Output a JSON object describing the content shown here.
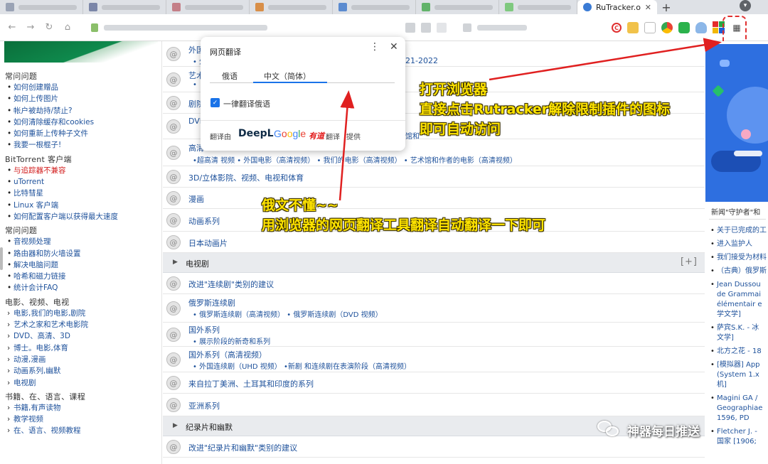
{
  "browser": {
    "active_tab_title": "RuTracker.o",
    "new_tab_glyph": "+",
    "tab_close_glyph": "✕"
  },
  "sidebar": {
    "sections": [
      {
        "title": "常问问题",
        "items": [
          "如何创建赠品",
          "如何上传图片",
          "帐户被劫持/禁止?",
          "如何清除缓存和cookies",
          "如何重新上传种子文件",
          "我要一根棍子!"
        ]
      },
      {
        "title": "BitTorrent 客户端",
        "items": [
          "与追踪器不兼容",
          "uTorrent",
          "比特彗星",
          "Linux 客户端",
          "如何配置客户端以获得最大速度"
        ]
      },
      {
        "title": "常问问题",
        "items": [
          "音视频处理",
          "路由器和防火墙设置",
          "解决电脑问题",
          "哈希和磁力链接",
          "统计会计FAQ"
        ]
      },
      {
        "title": "电影、视频、电视",
        "items": [
          "电影,我们的电影,剧院",
          "艺术之家和艺术电影院",
          "DVD、高清、3D",
          "博士。电影,体育",
          "动漫,漫画",
          "动画系列,幽默",
          "电视剧"
        ]
      },
      {
        "title": "书籍、在、语言、课程",
        "items": [
          "书籍,有声读物",
          "教学视频",
          "在、语言、视频教程"
        ]
      }
    ]
  },
  "main": {
    "rows": [
      {
        "title": "外国",
        "subs": "• 外",
        "suffix": "21-2022"
      },
      {
        "title": "艺术",
        "subs": "•"
      },
      {
        "title": "剧院",
        "subs": ""
      },
      {
        "title": "DVD",
        "subs": "",
        "suffix": "馆和"
      },
      {
        "title": "高清",
        "subs": "•超高清 视频 • 外国电影（高清视频） • 我们的电影（高清视频） • 艺术馆和作者的电影（高清视频）"
      },
      {
        "title": "3D/立体影院、视频、电视和体育",
        "subs": ""
      },
      {
        "title": "漫画",
        "subs": ""
      },
      {
        "title": "动画系列",
        "subs": ""
      },
      {
        "title": "日本动画片",
        "subs": ""
      }
    ],
    "cat_tv": {
      "title": "电视剧",
      "plus": "[+]"
    },
    "tv_rows": [
      {
        "title": "改进\"连续剧\"类别的建议",
        "subs": ""
      },
      {
        "title": "俄罗斯连续剧",
        "subs": "• 俄罗斯连续剧（高清视频） • 俄罗斯连续剧（DVD 视频）"
      },
      {
        "title": "国外系列",
        "subs": "• 展示阶段的新奇和系列"
      },
      {
        "title": "国外系列（高清视频）",
        "subs": "• 外国连续剧（UHD 视频） •新剧 和连续剧在表演阶段（高清视频）"
      },
      {
        "title": "来自拉丁美洲、土耳其和印度的系列",
        "subs": ""
      },
      {
        "title": "亚洲系列",
        "subs": ""
      }
    ],
    "cat_doc": {
      "title": "纪录片和幽默"
    },
    "doc_rows": [
      {
        "title": "改进\"纪录片和幽默\"类别的建议",
        "subs": ""
      }
    ]
  },
  "rightbar": {
    "heading": "新闻\"守护者\"和",
    "items": [
      "关于已完成的工",
      "进入监护人",
      "我们接受为材料",
      "（古典）俄罗斯",
      "Jean Dussou",
      "de Grammai",
      "élémentair e",
      "学文学]",
      "萨宾S.K. - 冰",
      "文学]",
      "北方之花 - 18",
      "[模拟器] App",
      "(System 1.x",
      "机]",
      "Magini GA /",
      "Geographiae",
      "1596, PD",
      "Fletcher J. -",
      "国家 [1906;"
    ]
  },
  "translate_popup": {
    "title": "网页翻译",
    "menu_glyph": "⋮",
    "close_glyph": "✕",
    "tab_source": "俄语",
    "tab_target": "中文（简体）",
    "checkbox_label": "一律翻译俄语",
    "checkbox_checked": true,
    "provided_prefix": "翻译由",
    "provider_deepl": "DeepL",
    "provider_google": "Google",
    "provider_youdao": "有道",
    "provider_fanyi": "翻译",
    "provided_suffix": "提供"
  },
  "annotations": {
    "top_right": [
      "打开浏览器",
      "直接点击Rutracker解除限制插件的图标",
      "即可自动访问"
    ],
    "middle": [
      "俄文不懂~~",
      "用浏览器的网页翻译工具翻译自动翻译一下即可"
    ]
  },
  "watermark": {
    "text": "神器每日推送"
  },
  "colors": {
    "link": "#20539c",
    "annotation": "#ffe400",
    "arrow": "#e02020",
    "translate_accent": "#1a73e8"
  }
}
